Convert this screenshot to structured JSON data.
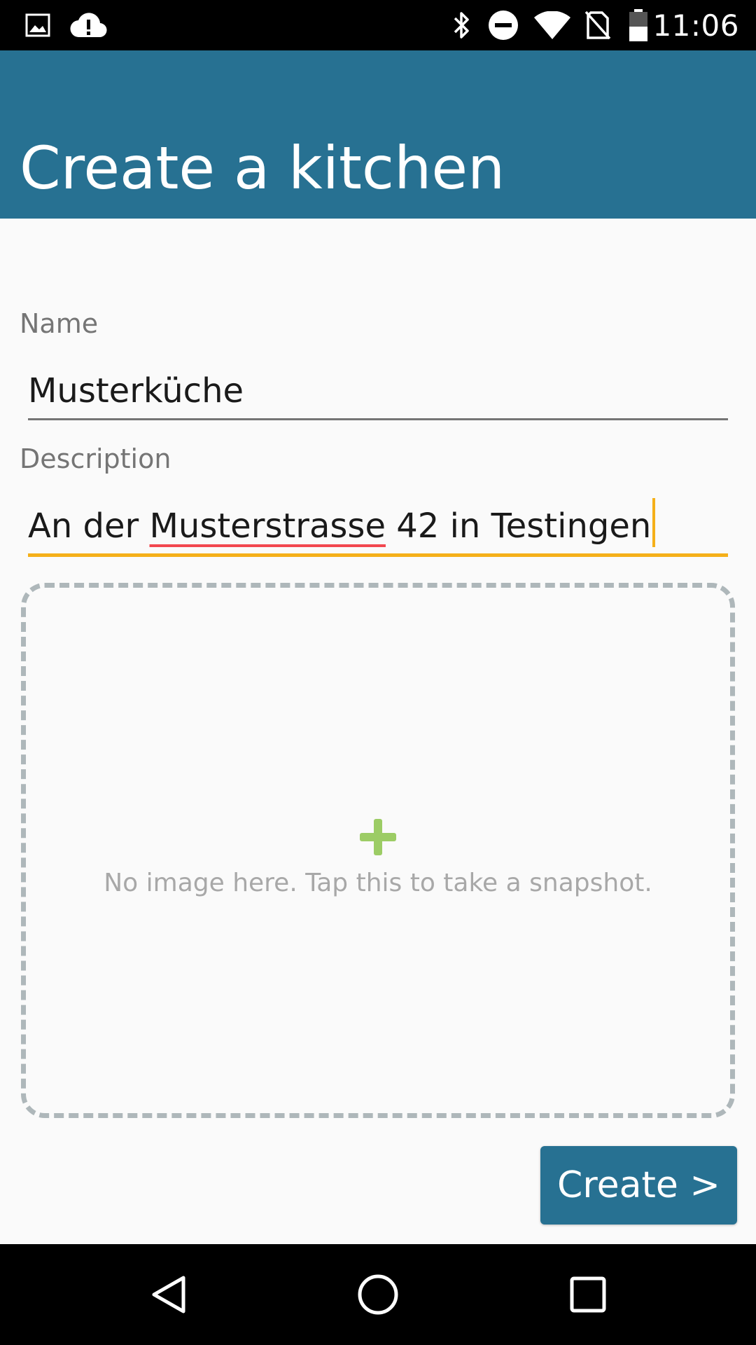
{
  "status_bar": {
    "time": "11:06",
    "left_icons": [
      "image-notification-icon",
      "cloud-alert-icon"
    ],
    "right_icons": [
      "bluetooth-icon",
      "do-not-disturb-icon",
      "wifi-icon",
      "no-sim-icon",
      "battery-icon"
    ]
  },
  "app_bar": {
    "title": "Create a kitchen",
    "color": "#277192"
  },
  "form": {
    "name": {
      "label": "Name",
      "value": "Musterküche"
    },
    "description": {
      "label": "Description",
      "value_prefix": "An der ",
      "value_misspelled": "Musterstrasse",
      "value_suffix": " 42 in Testingen",
      "focused": true,
      "accent_color": "#f5b019"
    }
  },
  "image_placeholder": {
    "icon": "plus-icon",
    "text": "No image here. Tap this to take a snapshot."
  },
  "actions": {
    "create_label": "Create >"
  },
  "nav_bar": {
    "buttons": [
      "back-icon",
      "home-icon",
      "recents-icon"
    ]
  }
}
